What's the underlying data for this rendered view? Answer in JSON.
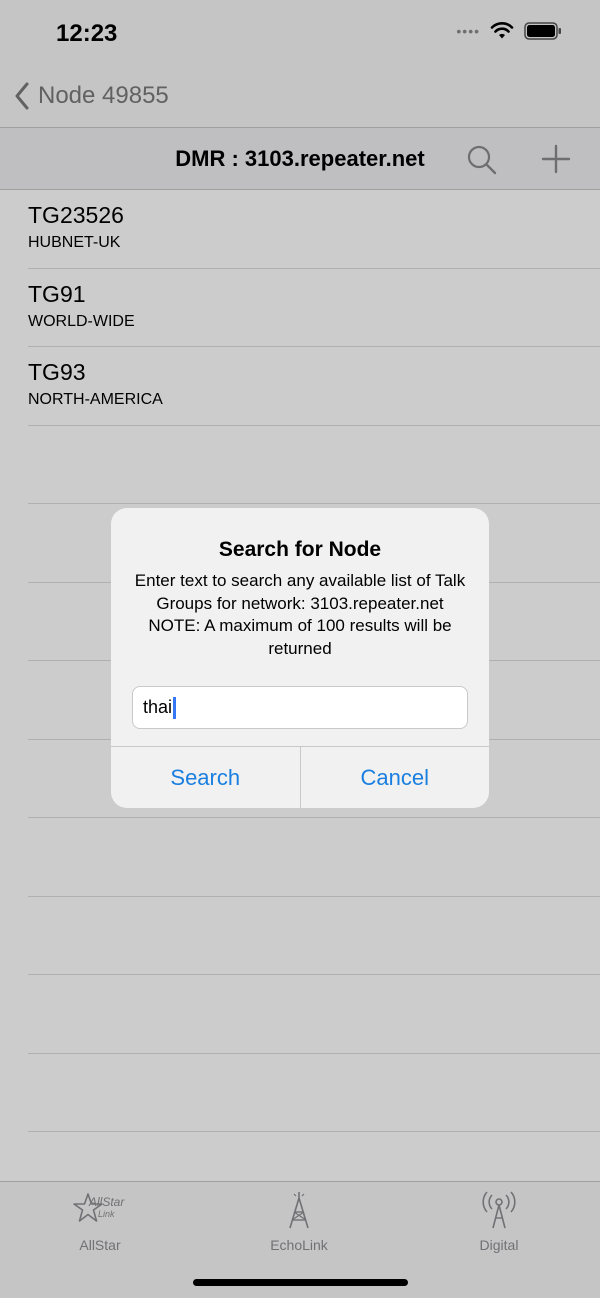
{
  "status_bar": {
    "time": "12:23"
  },
  "nav": {
    "back_label": "Node 49855"
  },
  "header": {
    "title": "DMR : 3103.repeater.net"
  },
  "list": [
    {
      "title": "TG23526",
      "subtitle": "HUBNET-UK"
    },
    {
      "title": "TG91",
      "subtitle": "WORLD-WIDE"
    },
    {
      "title": "TG93",
      "subtitle": "NORTH-AMERICA"
    }
  ],
  "tabs": [
    {
      "label": "AllStar",
      "icon": "allstar-link-icon"
    },
    {
      "label": "EchoLink",
      "icon": "radio-tower-icon"
    },
    {
      "label": "Digital",
      "icon": "broadcast-antenna-icon"
    }
  ],
  "alert": {
    "title": "Search for Node",
    "message": "Enter text to search any available list of Talk Groups for network: 3103.repeater.net  NOTE: A maximum of 100 results will be returned",
    "input_value": "thai",
    "search_label": "Search",
    "cancel_label": "Cancel"
  },
  "colors": {
    "accent": "#1a7fe0",
    "caret": "#3478f6",
    "overlay": "rgba(0,0,0,0.2)"
  }
}
